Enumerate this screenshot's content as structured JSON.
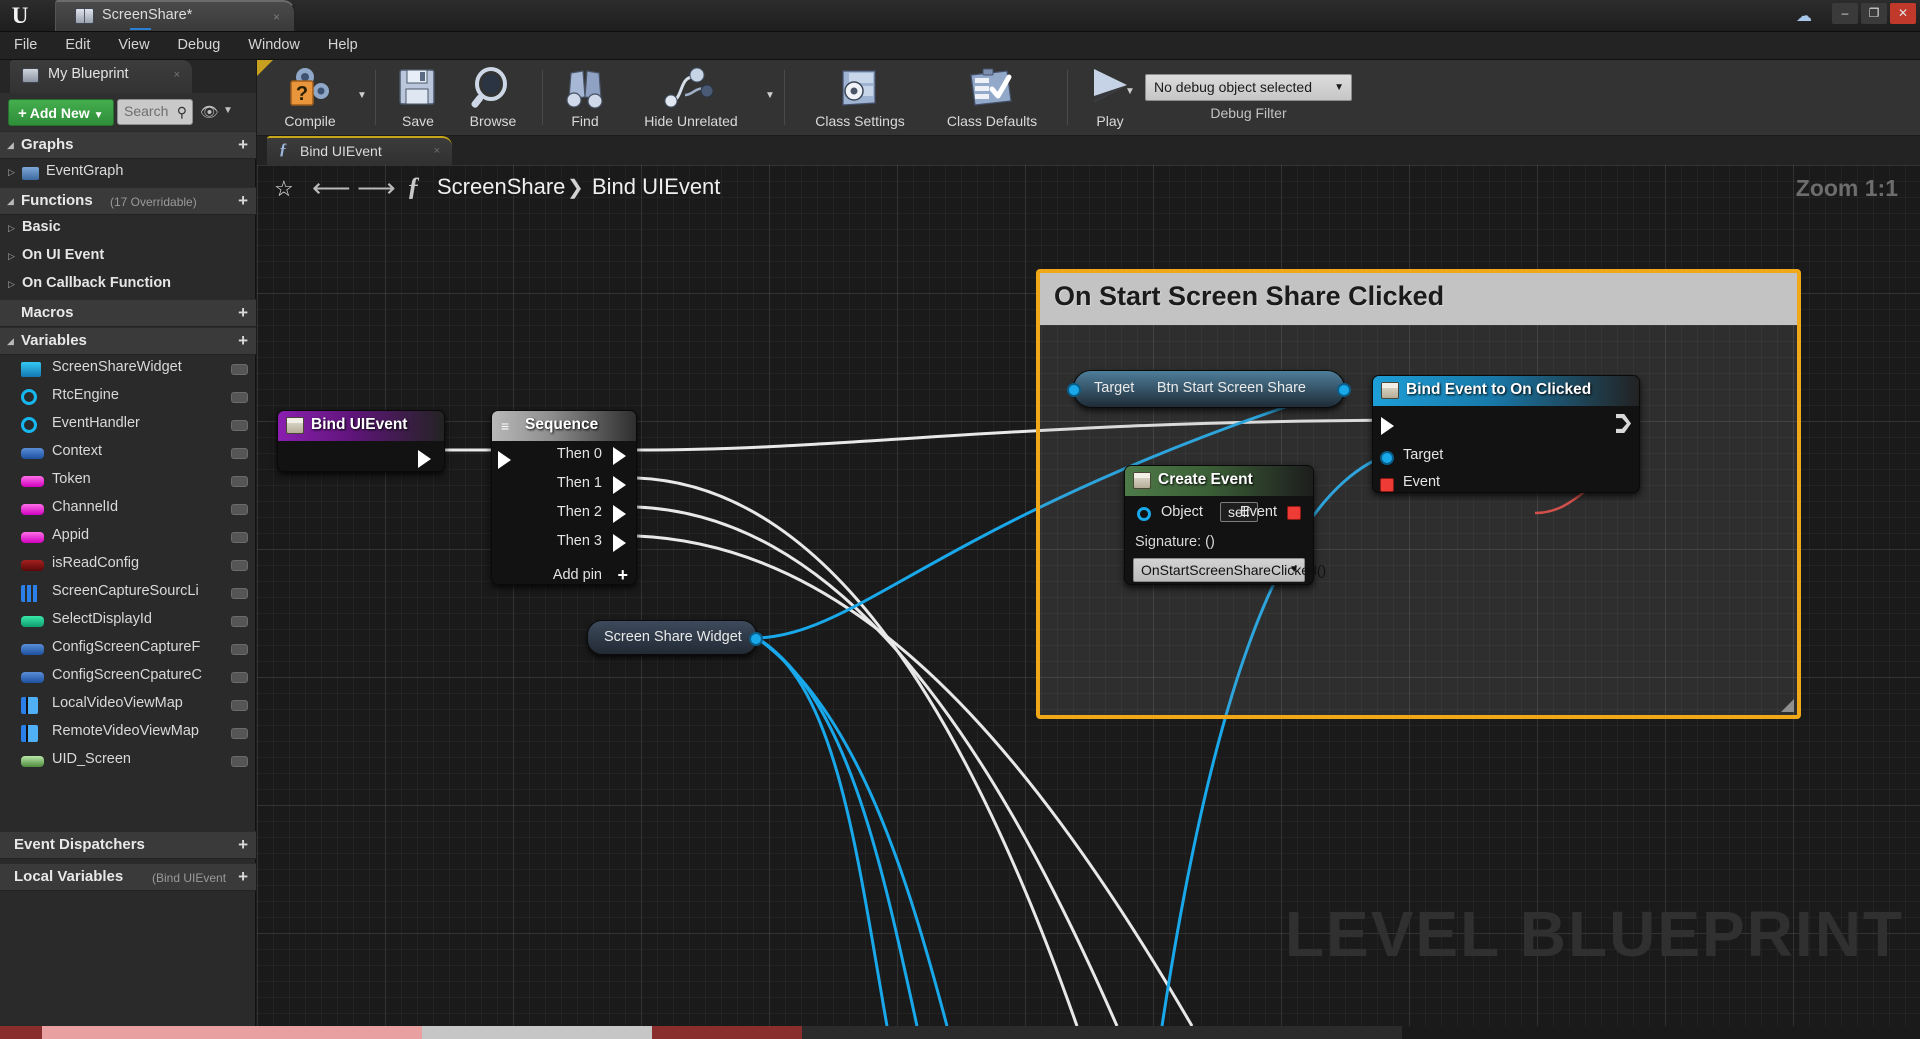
{
  "window": {
    "app_icon": "unreal-engine-logo",
    "tab_label": "ScreenShare*",
    "tab_close": "×",
    "minimize": "–",
    "maximize": "❐",
    "close": "✕",
    "cloud_icon": "cloud-icon"
  },
  "menubar": {
    "items": [
      {
        "label": "File"
      },
      {
        "label": "Edit"
      },
      {
        "label": "View"
      },
      {
        "label": "Debug"
      },
      {
        "label": "Window"
      },
      {
        "label": "Help"
      }
    ]
  },
  "myblueprint": {
    "tab_label": "My Blueprint",
    "tab_close": "×",
    "add_new_label": "Add New",
    "add_new_plus": "+",
    "add_new_caret": "▼",
    "search_placeholder": "Search",
    "search_icon": "magnifier-icon",
    "eye_icon": "eye-icon",
    "eye_caret": "▼",
    "sections": [
      {
        "name": "Graphs",
        "suffix": "",
        "arrow": "◢",
        "plus": "+"
      },
      {
        "name": "Functions",
        "suffix": "(17 Overridable)",
        "arrow": "◢",
        "plus": "+"
      },
      {
        "name": "Macros",
        "suffix": "",
        "arrow": "",
        "plus": "+"
      },
      {
        "name": "Variables",
        "suffix": "",
        "arrow": "◢",
        "plus": "+"
      },
      {
        "name": "Event Dispatchers",
        "suffix": "",
        "arrow": "",
        "plus": "+"
      },
      {
        "name": "Local Variables",
        "suffix": "(Bind UIEvent",
        "arrow": "",
        "plus": "+"
      }
    ],
    "graphs": [
      {
        "label": "EventGraph",
        "tri": "▷",
        "icon": "event-graph-icon"
      }
    ],
    "functions": [
      {
        "label": "Basic",
        "tri": "▷"
      },
      {
        "label": "On UI Event",
        "tri": "▷"
      },
      {
        "label": "On Callback Function",
        "tri": "▷"
      }
    ],
    "variables": [
      {
        "label": "ScreenShareWidget",
        "type": "widget"
      },
      {
        "label": "RtcEngine",
        "type": "object"
      },
      {
        "label": "EventHandler",
        "type": "object"
      },
      {
        "label": "Context",
        "type": "struct"
      },
      {
        "label": "Token",
        "type": "string"
      },
      {
        "label": "ChannelId",
        "type": "string"
      },
      {
        "label": "Appid",
        "type": "string"
      },
      {
        "label": "isReadConfig",
        "type": "bool"
      },
      {
        "label": "ScreenCaptureSourcLi",
        "type": "array"
      },
      {
        "label": "SelectDisplayId",
        "type": "int"
      },
      {
        "label": "ConfigScreenCaptureF",
        "type": "struct"
      },
      {
        "label": "ConfigScreenCpatureC",
        "type": "struct"
      },
      {
        "label": "LocalVideoViewMap",
        "type": "map"
      },
      {
        "label": "RemoteVideoViewMap",
        "type": "map"
      },
      {
        "label": "UID_Screen",
        "type": "uid"
      }
    ]
  },
  "toolbar": {
    "buttons": [
      {
        "label": "Compile",
        "icon": "compile-question-gear-icon",
        "caret": "▼"
      },
      {
        "label": "Save",
        "icon": "floppy-disk-icon"
      },
      {
        "label": "Browse",
        "icon": "magnifier-icon"
      },
      {
        "label": "Find",
        "icon": "binoculars-icon"
      },
      {
        "label": "Hide Unrelated",
        "icon": "node-graph-icon",
        "caret": "▼"
      },
      {
        "label": "Class Settings",
        "icon": "class-settings-gear-icon"
      },
      {
        "label": "Class Defaults",
        "icon": "clipboard-check-icon"
      },
      {
        "label": "Play",
        "icon": "play-triangle-icon",
        "caret": "▼"
      }
    ],
    "debug_object": "No debug object selected",
    "debug_object_caret": "▼",
    "debug_filter_label": "Debug Filter"
  },
  "graph_tab": {
    "label": "Bind UIEvent",
    "fx_icon": "function-f-icon",
    "close": "×"
  },
  "breadcrumb": {
    "star_icon": "star-icon",
    "back_icon": "arrow-left-icon",
    "forward_icon": "arrow-right-icon",
    "fx_icon": "function-f-icon",
    "part1": "ScreenShare",
    "separator": "❯",
    "part2": "Bind UIEvent",
    "zoom_label": "Zoom 1:1"
  },
  "canvas": {
    "watermark": "LEVEL BLUEPRINT",
    "comment": {
      "title": "On Start Screen Share Clicked",
      "border_color": "#f0a818"
    },
    "nodes": [
      {
        "id": "bind-uievent",
        "title": "Bind UIEvent",
        "header_color": "#8b1fb0",
        "icon": "blueprint-function-icon",
        "out_exec": ""
      },
      {
        "id": "sequence",
        "title": "Sequence",
        "header_color": "#b8b8b8",
        "icon": "sequence-icon",
        "pins": [
          "Then 0",
          "Then 1",
          "Then 2",
          "Then 3"
        ],
        "add_pin_label": "Add pin",
        "add_pin_plus": "+"
      },
      {
        "id": "screen-share-widget",
        "title": "Screen Share Widget",
        "type": "variable-get"
      },
      {
        "id": "btn-start-screen-share",
        "target_label": "Target",
        "title": "Btn Start Screen Share",
        "type": "variable-get-member"
      },
      {
        "id": "bind-event-to-on-clicked",
        "title": "Bind Event to On Clicked",
        "header_color": "#1d9fd8",
        "icon": "blueprint-function-icon",
        "pins": [
          "Target",
          "Event"
        ]
      },
      {
        "id": "create-event",
        "title": "Create Event",
        "header_color": "#4e7a48",
        "icon": "blueprint-function-icon",
        "object_label": "Object",
        "object_value": "self",
        "event_label": "Event",
        "signature_label": "Signature: ()",
        "combo_value": "OnStartScreenShareClicked()",
        "combo_caret": "▼"
      }
    ]
  }
}
